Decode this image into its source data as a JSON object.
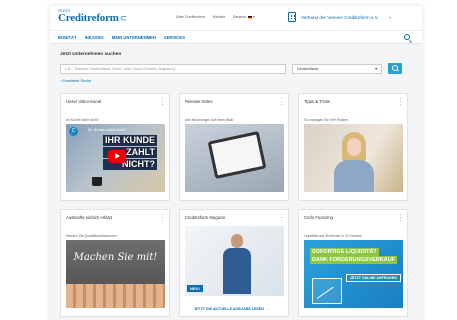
{
  "header": {
    "logo_prefix": "mein",
    "logo_brand": "Creditreform",
    "links": [
      "Über Creditreform",
      "Kontakt",
      "Deutsch"
    ],
    "org_name": "Verband der Vereine Creditreform e.V."
  },
  "nav": {
    "items": [
      "BONITÄT",
      "INKASSO",
      "MEIN UNTERNEHMEN",
      "SERVICES"
    ]
  },
  "search": {
    "title": "Jetzt Unternehmen suchen",
    "placeholder": "z.B. \"Telekom Deutschland, Bonn\" oder \"Kuka Roboter, Augsburg\"",
    "country": "Deutschland",
    "extended_link": "Erweiterte Suche"
  },
  "cards": [
    {
      "title": "Unser Video-Kanal",
      "subtitle": "Ihr Kunde zahlt nicht?",
      "overlay_small": "Ihr Kunde zahlt nicht?",
      "overlay_lines": [
        "IHR KUNDE",
        "ZAHLT",
        "NICHT?"
      ]
    },
    {
      "title": "Release Notes",
      "subtitle": "Alle Neuerungen auf einen Blick"
    },
    {
      "title": "Tipps & Tricks",
      "subtitle": "So managen Sie Ihre Risiken"
    },
    {
      "title": "Auskünfte einfach erklärt",
      "subtitle": "Werden Sie Qualitätsverbesserer!",
      "overlay": "Machen Sie mit!"
    },
    {
      "title": "Creditreform Magazin",
      "badge": "NEU!",
      "link": "JETZT DIE AKTUELLE AUSGABE LESEN →"
    },
    {
      "title": "Crefo Factoring",
      "subtitle": "Liquidität und Sicherheit in 24 Stunden",
      "overlay_lines": [
        "SOFORTIGE LIQUIDITÄT",
        "DANK FORDERUNGSVERKAUF"
      ],
      "cta": "JETZT ONLINE ANFRAGEN"
    }
  ],
  "colors": {
    "primary": "#0a6eb4",
    "accent": "#2a9fd8",
    "green": "#8dc63f"
  }
}
